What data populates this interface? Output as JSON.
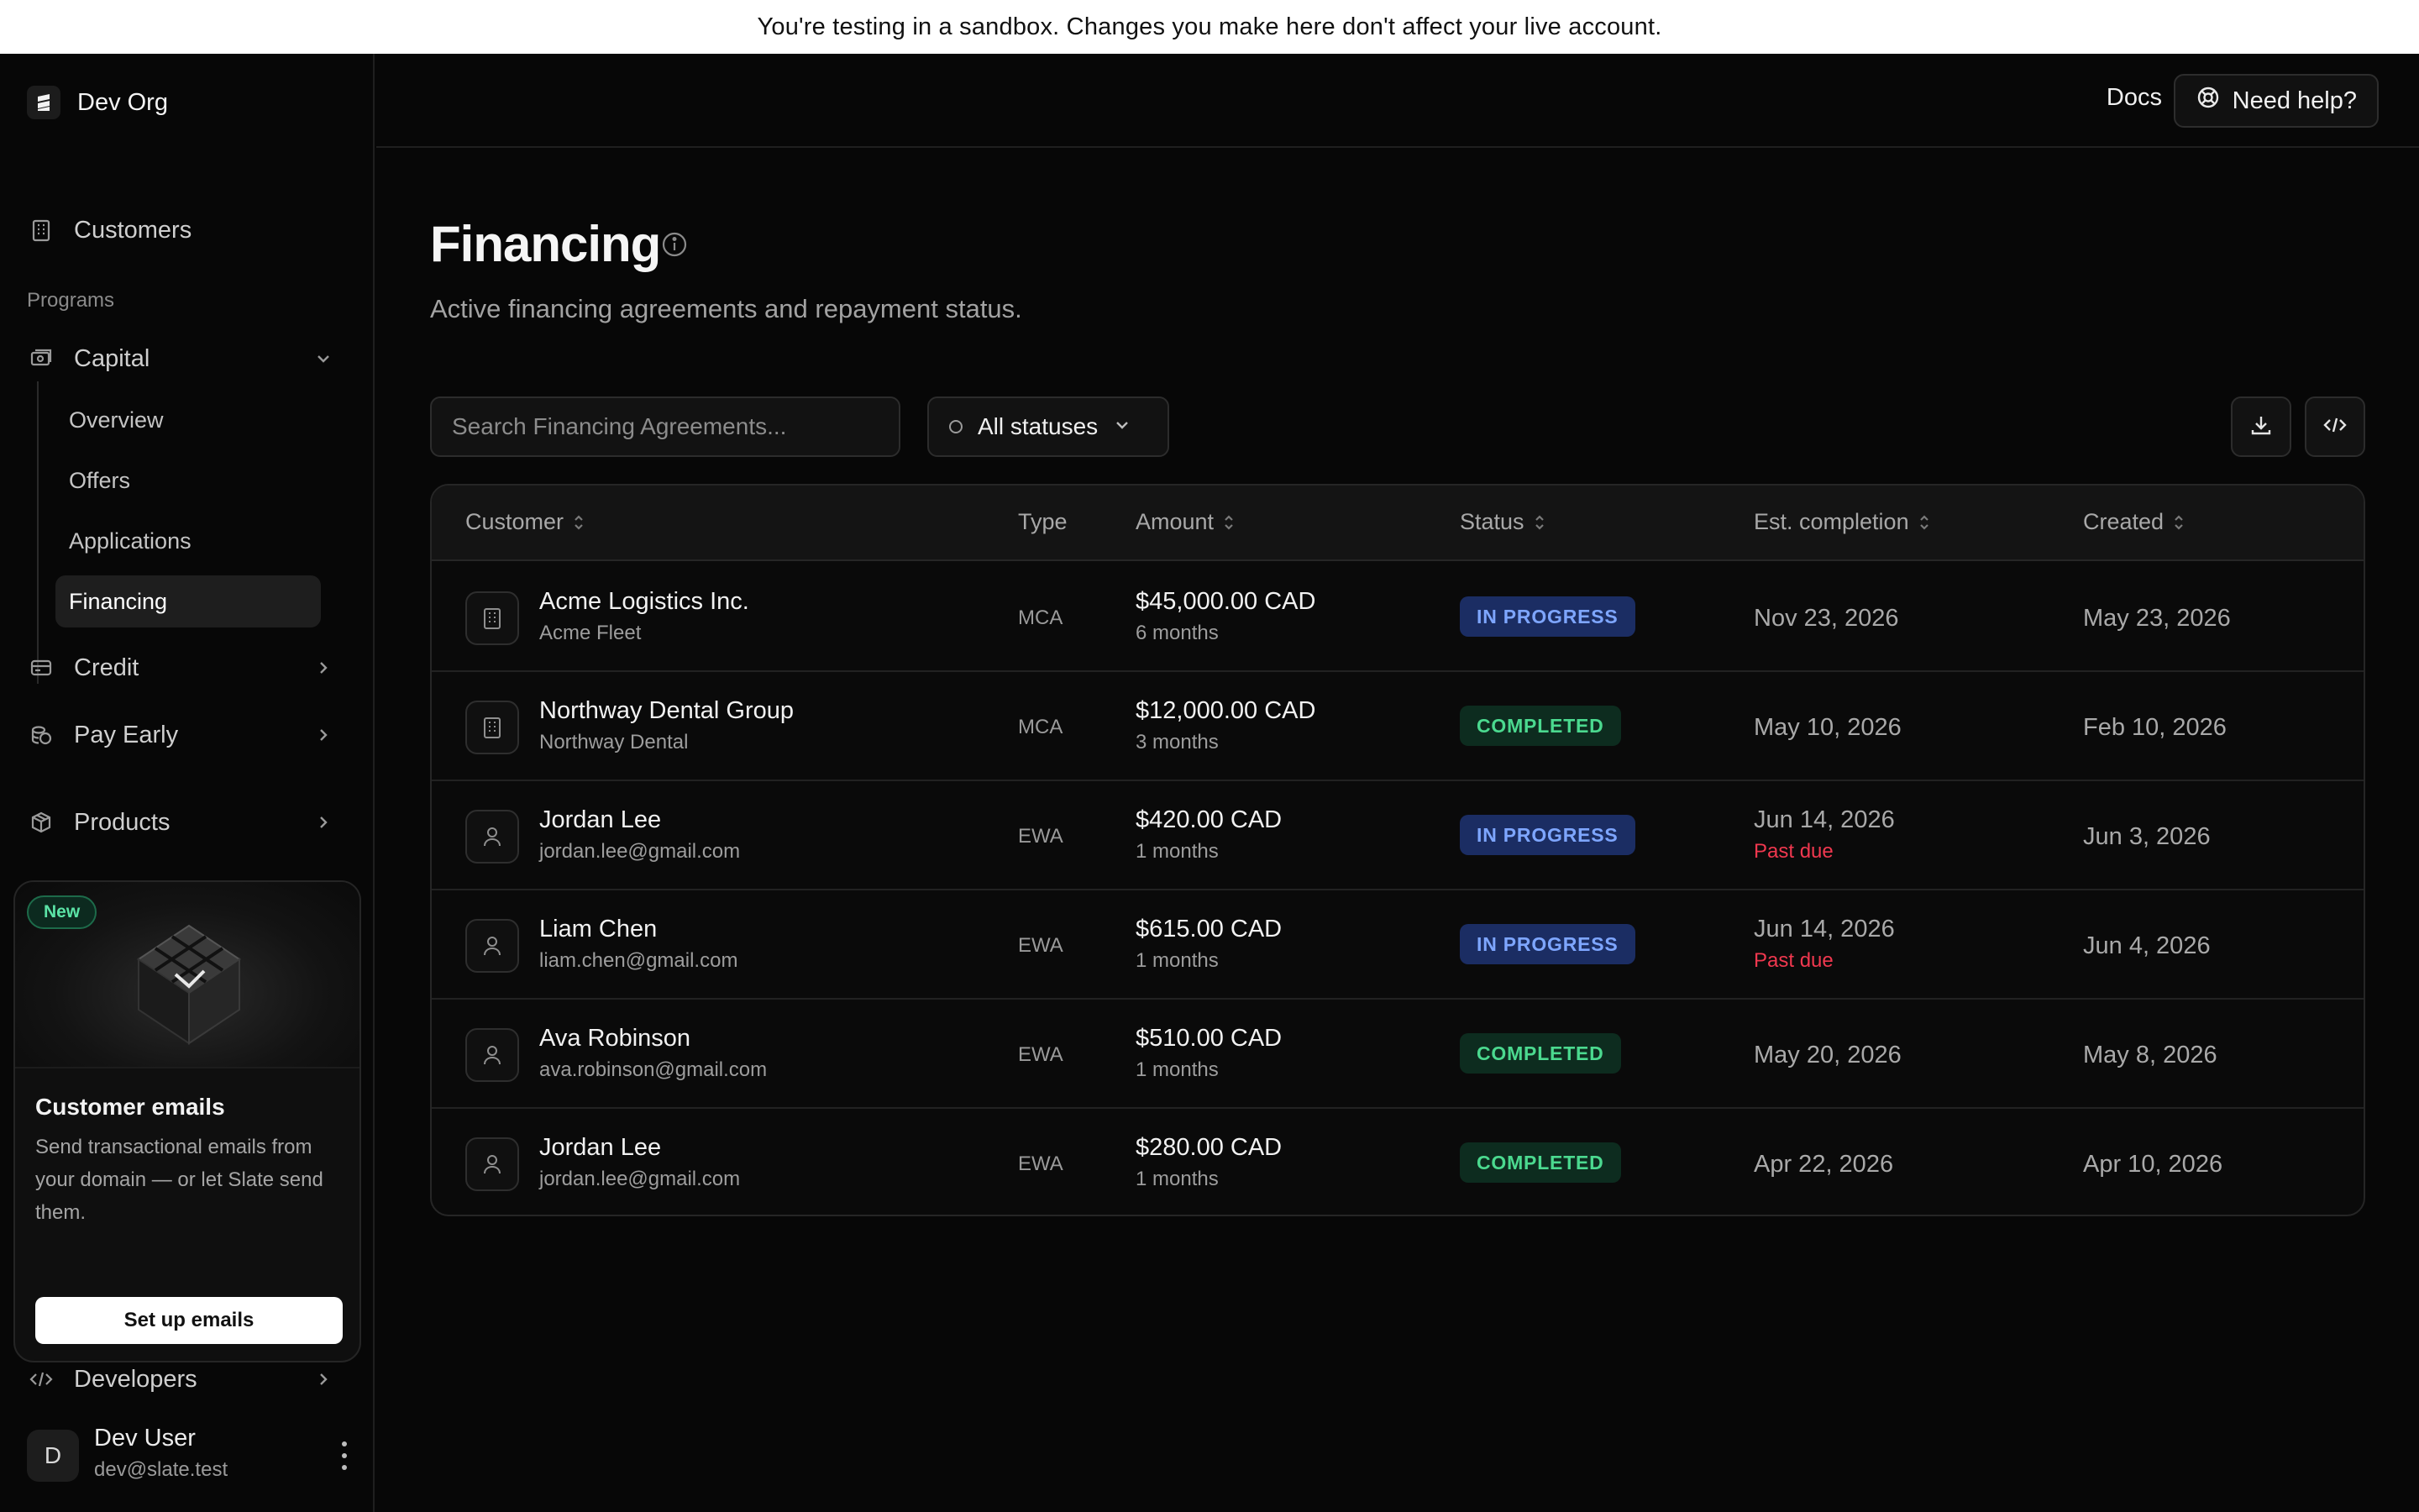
{
  "banner": {
    "text": "You're testing in a sandbox. Changes you make here don't affect your live account."
  },
  "sidebar": {
    "org_name": "Dev Org",
    "customers_label": "Customers",
    "section_label": "Programs",
    "capital_label": "Capital",
    "capital_sub": [
      "Overview",
      "Offers",
      "Applications",
      "Financing"
    ],
    "credit_label": "Credit",
    "pay_early_label": "Pay Early",
    "products_label": "Products",
    "developers_label": "Developers",
    "promo": {
      "badge": "New",
      "title": "Customer emails",
      "text": "Send transactional emails from your domain — or let Slate send them.",
      "button": "Set up emails"
    },
    "user": {
      "initial": "D",
      "name": "Dev User",
      "email": "dev@slate.test"
    }
  },
  "header": {
    "docs_label": "Docs",
    "help_label": "Need help?"
  },
  "page": {
    "title": "Financing",
    "subtitle": "Active financing agreements and repayment status."
  },
  "toolbar": {
    "search_placeholder": "Search Financing Agreements...",
    "filter_label": "All statuses"
  },
  "table": {
    "columns": [
      "Customer",
      "Type",
      "Amount",
      "Status",
      "Est. completion",
      "Created"
    ],
    "rows": [
      {
        "icon": "building-icon",
        "name": "Acme Logistics Inc.",
        "sub": "Acme Fleet",
        "type": "MCA",
        "amount": "$45,000.00 CAD",
        "term": "6 months",
        "status": "IN PROGRESS",
        "status_kind": "progress",
        "est": "Nov 23, 2026",
        "past_due": "",
        "created": "May 23, 2026"
      },
      {
        "icon": "building-icon",
        "name": "Northway Dental Group",
        "sub": "Northway Dental",
        "type": "MCA",
        "amount": "$12,000.00 CAD",
        "term": "3 months",
        "status": "COMPLETED",
        "status_kind": "completed",
        "est": "May 10, 2026",
        "past_due": "",
        "created": "Feb 10, 2026"
      },
      {
        "icon": "person-icon",
        "name": "Jordan Lee",
        "sub": "jordan.lee@gmail.com",
        "type": "EWA",
        "amount": "$420.00 CAD",
        "term": "1 months",
        "status": "IN PROGRESS",
        "status_kind": "progress",
        "est": "Jun 14, 2026",
        "past_due": "Past due",
        "created": "Jun 3, 2026"
      },
      {
        "icon": "person-icon",
        "name": "Liam Chen",
        "sub": "liam.chen@gmail.com",
        "type": "EWA",
        "amount": "$615.00 CAD",
        "term": "1 months",
        "status": "IN PROGRESS",
        "status_kind": "progress",
        "est": "Jun 14, 2026",
        "past_due": "Past due",
        "created": "Jun 4, 2026"
      },
      {
        "icon": "person-icon",
        "name": "Ava Robinson",
        "sub": "ava.robinson@gmail.com",
        "type": "EWA",
        "amount": "$510.00 CAD",
        "term": "1 months",
        "status": "COMPLETED",
        "status_kind": "completed",
        "est": "May 20, 2026",
        "past_due": "",
        "created": "May 8, 2026"
      },
      {
        "icon": "person-icon",
        "name": "Jordan Lee",
        "sub": "jordan.lee@gmail.com",
        "type": "EWA",
        "amount": "$280.00 CAD",
        "term": "1 months",
        "status": "COMPLETED",
        "status_kind": "completed",
        "est": "Apr 22, 2026",
        "past_due": "",
        "created": "Apr 10, 2026"
      }
    ]
  },
  "colors": {
    "accent_progress": "#7ea6ff",
    "accent_completed": "#4bd98f",
    "past_due": "#f0384f",
    "background": "#070707"
  }
}
